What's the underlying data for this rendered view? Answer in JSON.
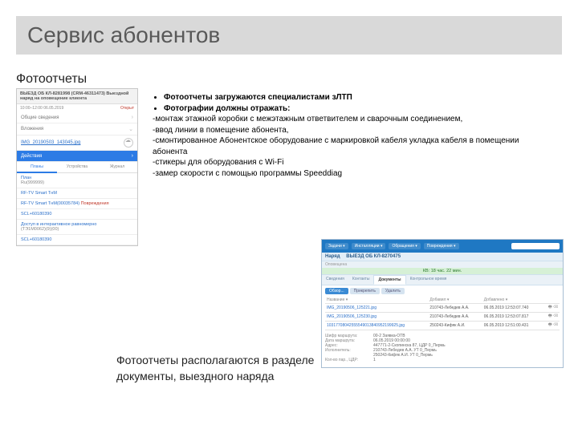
{
  "title": "Сервис абонентов",
  "subhead": "Фотоотчеты",
  "bullets": {
    "b1": "Фотоотчеты загружаются специалистами зЛТП",
    "b2": "Фотографии должны отражать:",
    "d1": "-монтаж этажной коробки с межэтажным ответвителем и сварочным соединением,",
    "d2": "-ввод линии в помещение абонента,",
    "d3": "-смонтированное Абонентское оборудование с маркировкой кабеля укладка кабеля в помещении абонента",
    "d4": "-стикеры для оборудования с Wi-Fi",
    "d5": "-замер скорости с помощью программы Speeddiag"
  },
  "mobile": {
    "head": "ВЫЕЗД ОБ КЛ-8281998 (CRM-46311473) Выездной наряд на оповещение клиента",
    "sub_time": "10:00–12:00 06.05.2019",
    "sub_status": "Открыт",
    "sec_info": "Общие сведения",
    "sec_att": "Вложения",
    "att": "IMG_20190503_143045.jpg",
    "sec_act": "Действия",
    "tabs": {
      "t1": "Планы",
      "t2": "Устройства",
      "t3": "Журнал"
    },
    "list": {
      "i1": "План",
      "i1s": "Ru(999999)",
      "i2": "RF-TV Smart ТнМ",
      "i3": "RF-TV Smart ТнМ(00035784)",
      "i3w": "Повреждения",
      "i4": "SCL+60180390",
      "i5": "Доступ в интерактивное равномерно",
      "i5s": "(ТЭ1М0062)(9)(00)",
      "i6": "SCL+60180390"
    }
  },
  "desktop": {
    "top": {
      "m1": "Задачи ▾",
      "m2": "Инсталляции ▾",
      "m3": "Обращения ▾",
      "m4": "Повреждения ▾"
    },
    "bar2_l": "Наряд",
    "bar2_r": "ВЫЕЗД ОБ КЛ-8270475",
    "kv": "КВ: 18 час. 22 мин.",
    "un": "Оповещена",
    "tabs": {
      "t1": "Сведения",
      "t2": "Контакты",
      "t3": "Документы",
      "t4": "Контрольное время"
    },
    "btn1": "Обзор...",
    "btn2": "Прикрепить",
    "btn3": "Удалить",
    "table": {
      "head": {
        "c1": "Название ▾",
        "c2": "Добавил ▾",
        "c3": "Добавлено ▾"
      },
      "rows": [
        {
          "c1": "IMG_20190506_125221.jpg",
          "c2": "210743-Лебедев А.А.",
          "c3": "06.05.2019 12:53:07.740",
          "ic": "🖶 ⌫"
        },
        {
          "c1": "IMG_20190506_125230.jpg",
          "c2": "210743-Лебедев А.А.",
          "c3": "06.05.2019 12:53:07.817",
          "ic": "🖶 ⌫"
        },
        {
          "c1": "10317708042555549013840952199925.jpg",
          "c2": "250243-Кифяк А.И.",
          "c3": "06.05.2019 12:51:00.431",
          "ic": "🖶 ⌫"
        }
      ]
    },
    "meta": {
      "r1k": "Шифр маршрута:",
      "r1v": "00-2 Заявка-ОТВ",
      "r2k": "Дата маршрута:",
      "r2v": "06.05.2019 00:00:00",
      "r3k": "Адрес:",
      "r3v": "447771-2-Скопинска 87, ЦДР 0_Пермь",
      "r4k": "Исполнитель:",
      "r4v": "210743-Лебедев А.А. УТ 0_Пермь",
      "r5k": "",
      "r5v": "250243-Кифяк А.И. УТ 0_Пермь",
      "r6k": "Кол-во пар., ЦДР:",
      "r6v": "1"
    }
  },
  "caption": "Фотоотчеты располагаются в разделе документы, выездного наряда"
}
